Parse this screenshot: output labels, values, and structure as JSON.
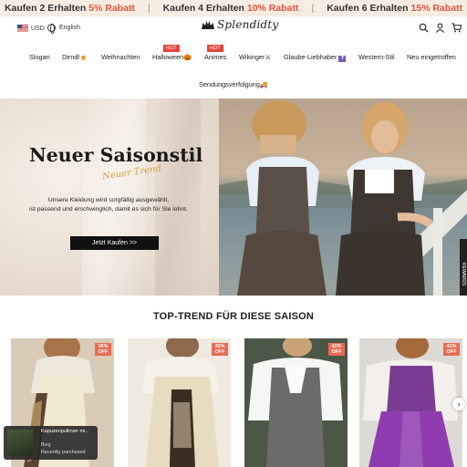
{
  "promo": {
    "offers": [
      {
        "text": "Kaufen 2 Erhalten ",
        "discount": "5% Rabatt"
      },
      {
        "text": "Kaufen 4 Erhalten ",
        "discount": "10% Rabatt"
      },
      {
        "text": "Kaufen 6 Erhalten ",
        "discount": "15% Rabatt"
      }
    ],
    "separator": "|"
  },
  "header": {
    "currency": "USD",
    "language": "English",
    "logo_text": "Splendidty"
  },
  "nav": {
    "hot_badge": "HOT",
    "items": [
      "Slogan",
      "Dirndl",
      "Weihnachten",
      "Halloween",
      "Animes",
      "Wikinger",
      "Glaube-Liebhaber",
      "Western-Stil",
      "Neu eingetroffen"
    ],
    "second_row": "Sendungsverfolgung"
  },
  "hero": {
    "title": "Neuer Saisonstil",
    "script": "Neuer Trend",
    "description_line1": "Unsere Kleidung wird sorgfältig ausgewählt,",
    "description_line2": "ist passend und erschwinglich, damit es sich für Sie lohnt.",
    "button": "Jetzt Kaufen >>",
    "side_tab": "REWARDS"
  },
  "section": {
    "title": "TOP-TREND FÜR DIESE SAISON"
  },
  "products": [
    {
      "badge_pct": "36%",
      "badge_off": "OFF"
    },
    {
      "badge_pct": "30%",
      "badge_off": "OFF"
    },
    {
      "badge_pct": "42%",
      "badge_off": "OFF"
    },
    {
      "badge_pct": "41%",
      "badge_off": "OFF"
    }
  ],
  "recent_purchase": {
    "product": "Kapuzenpullover mi...",
    "location": "Borg",
    "status": "Recently purchased"
  },
  "colors": {
    "promo_bg": "#f6ece2",
    "accent": "#e0563e",
    "hot": "#e8433a",
    "badge": "#e86b55",
    "button": "#111111"
  }
}
